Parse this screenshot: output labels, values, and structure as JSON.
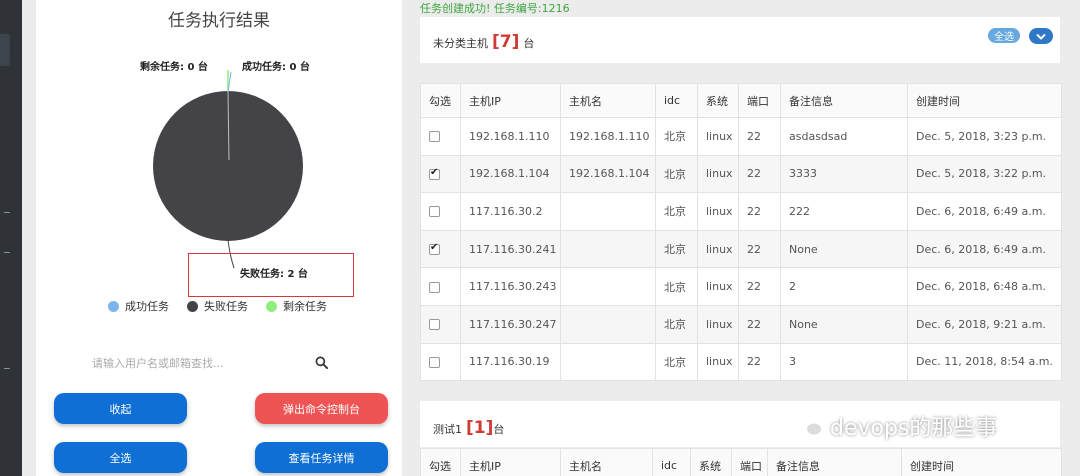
{
  "left_panel": {
    "title": "任务执行结果",
    "pie": {
      "labels": {
        "remaining": "剩余任务: 0 台",
        "success": "成功任务: 0 台",
        "failed": "失败任务: 2 台"
      },
      "legend": [
        {
          "label": "成功任务",
          "color": "#7cb5ec"
        },
        {
          "label": "失败任务",
          "color": "#434348"
        },
        {
          "label": "剩余任务",
          "color": "#90ed7d"
        }
      ],
      "values": {
        "success": 0,
        "failed": 2,
        "remaining": 0
      }
    },
    "search": {
      "placeholder": "请输入用户名或邮箱查找..."
    },
    "buttons": {
      "collapse": "收起",
      "open_console": "弹出命令控制台",
      "select_all": "全选",
      "view_details": "查看任务详情"
    }
  },
  "toast": "任务创建成功! 任务编号:1216",
  "group1": {
    "title_prefix": "未分类主机",
    "count": "[7]",
    "title_suffix": "台",
    "select_all": "全选",
    "headers": [
      "勾选",
      "主机IP",
      "主机名",
      "idc",
      "系统",
      "端口",
      "备注信息",
      "创建时间"
    ],
    "rows": [
      {
        "checked": false,
        "ip": "192.168.1.110",
        "hostname": "192.168.1.110",
        "idc": "北京",
        "os": "linux",
        "port": "22",
        "note": "asdasdsad",
        "created": "Dec. 5, 2018, 3:23 p.m."
      },
      {
        "checked": true,
        "ip": "192.168.1.104",
        "hostname": "192.168.1.104",
        "idc": "北京",
        "os": "linux",
        "port": "22",
        "note": "3333",
        "created": "Dec. 5, 2018, 3:22 p.m."
      },
      {
        "checked": false,
        "ip": "117.116.30.2",
        "hostname": "",
        "idc": "北京",
        "os": "linux",
        "port": "22",
        "note": "222",
        "created": "Dec. 6, 2018, 6:49 a.m."
      },
      {
        "checked": true,
        "ip": "117.116.30.241",
        "hostname": "",
        "idc": "北京",
        "os": "linux",
        "port": "22",
        "note": "None",
        "created": "Dec. 6, 2018, 6:49 a.m."
      },
      {
        "checked": false,
        "ip": "117.116.30.243",
        "hostname": "",
        "idc": "北京",
        "os": "linux",
        "port": "22",
        "note": "2",
        "created": "Dec. 6, 2018, 6:48 a.m."
      },
      {
        "checked": false,
        "ip": "117.116.30.247",
        "hostname": "",
        "idc": "北京",
        "os": "linux",
        "port": "22",
        "note": "None",
        "created": "Dec. 6, 2018, 9:21 a.m."
      },
      {
        "checked": false,
        "ip": "117.116.30.19",
        "hostname": "",
        "idc": "北京",
        "os": "linux",
        "port": "22",
        "note": "3",
        "created": "Dec. 11, 2018, 8:54 a.m."
      }
    ]
  },
  "group2": {
    "title_prefix": "测试1",
    "count": "[1]",
    "title_suffix": "台",
    "headers": [
      "勾选",
      "主机IP",
      "主机名",
      "idc",
      "系统",
      "端口",
      "备注信息",
      "创建时间"
    ]
  },
  "watermark": "devops的那些事",
  "colors": {
    "accent_blue": "#0f6fd4",
    "accent_red": "#ee5454",
    "count_red": "#d03b33",
    "toast_green": "#3fa63f"
  }
}
